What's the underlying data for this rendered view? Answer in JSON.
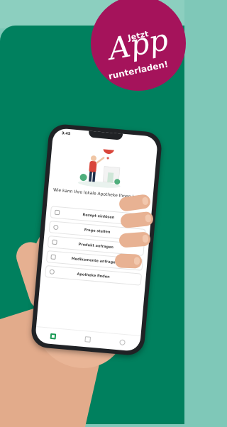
{
  "promo": {
    "line1": "Jetzt",
    "line2": "App",
    "line3": "runterladen!"
  },
  "phone": {
    "status_time": "3:45",
    "question": "Wie kann Ihre lokale Apotheke Ihnen helfen?",
    "menu_items": [
      {
        "label": "Rezept einlösen",
        "icon": "receipt-icon"
      },
      {
        "label": "Frage stellen",
        "icon": "chat-icon"
      },
      {
        "label": "Produkt anfragen",
        "icon": "cart-icon"
      },
      {
        "label": "Medikamente anfragen",
        "icon": "pill-icon"
      },
      {
        "label": "Apotheke finden",
        "icon": "search-icon"
      }
    ],
    "bottom_nav": [
      "home-icon",
      "message-icon",
      "profile-icon"
    ]
  },
  "colors": {
    "background_green": "#00805e",
    "badge_magenta": "#a5135b",
    "accent_green": "#1a9a55"
  }
}
